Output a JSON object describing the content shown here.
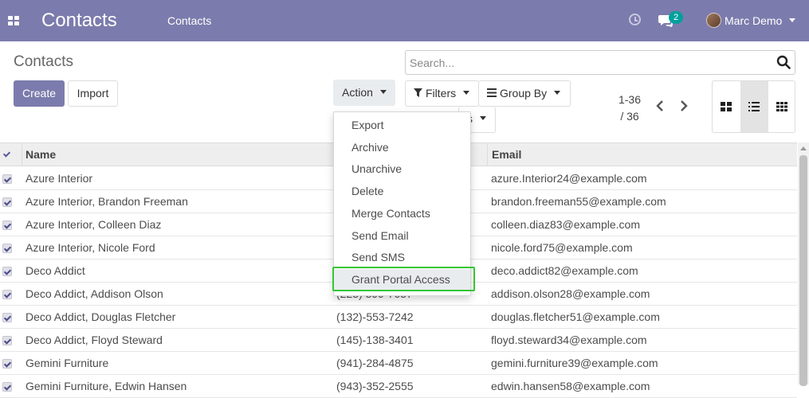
{
  "navbar": {
    "app_title": "Contacts",
    "menu_item": "Contacts",
    "message_count": "2",
    "user_name": "Marc Demo",
    "bg_color": "#7c7bad"
  },
  "control_panel": {
    "breadcrumb": "Contacts",
    "search_placeholder": "Search...",
    "create_label": "Create",
    "import_label": "Import",
    "action_label": "Action",
    "filters_label": "Filters",
    "groupby_label": "Group By",
    "favorites_partial": "s",
    "pager_value": "1-36",
    "pager_limit": "/ 36"
  },
  "action_menu": {
    "items": [
      "Export",
      "Archive",
      "Unarchive",
      "Delete",
      "Merge Contacts",
      "Send Email",
      "Send SMS",
      "Grant Portal Access"
    ],
    "highlighted": "Grant Portal Access"
  },
  "table": {
    "columns": [
      "Name",
      "Email"
    ],
    "rows": [
      {
        "name": "Azure Interior",
        "phone": "",
        "email": "azure.Interior24@example.com"
      },
      {
        "name": "Azure Interior, Brandon Freeman",
        "phone": "",
        "email": "brandon.freeman55@example.com"
      },
      {
        "name": "Azure Interior, Colleen Diaz",
        "phone": "",
        "email": "colleen.diaz83@example.com"
      },
      {
        "name": "Azure Interior, Nicole Ford",
        "phone": "",
        "email": "nicole.ford75@example.com"
      },
      {
        "name": "Deco Addict",
        "phone": "",
        "email": "deco.addict82@example.com"
      },
      {
        "name": "Deco Addict, Addison Olson",
        "phone": "(223) 399-7637",
        "email": "addison.olson28@example.com"
      },
      {
        "name": "Deco Addict, Douglas Fletcher",
        "phone": "(132)-553-7242",
        "email": "douglas.fletcher51@example.com"
      },
      {
        "name": "Deco Addict, Floyd Steward",
        "phone": "(145)-138-3401",
        "email": "floyd.steward34@example.com"
      },
      {
        "name": "Gemini Furniture",
        "phone": "(941)-284-4875",
        "email": "gemini.furniture39@example.com"
      },
      {
        "name": "Gemini Furniture, Edwin Hansen",
        "phone": "(943)-352-2555",
        "email": "edwin.hansen58@example.com"
      }
    ]
  }
}
